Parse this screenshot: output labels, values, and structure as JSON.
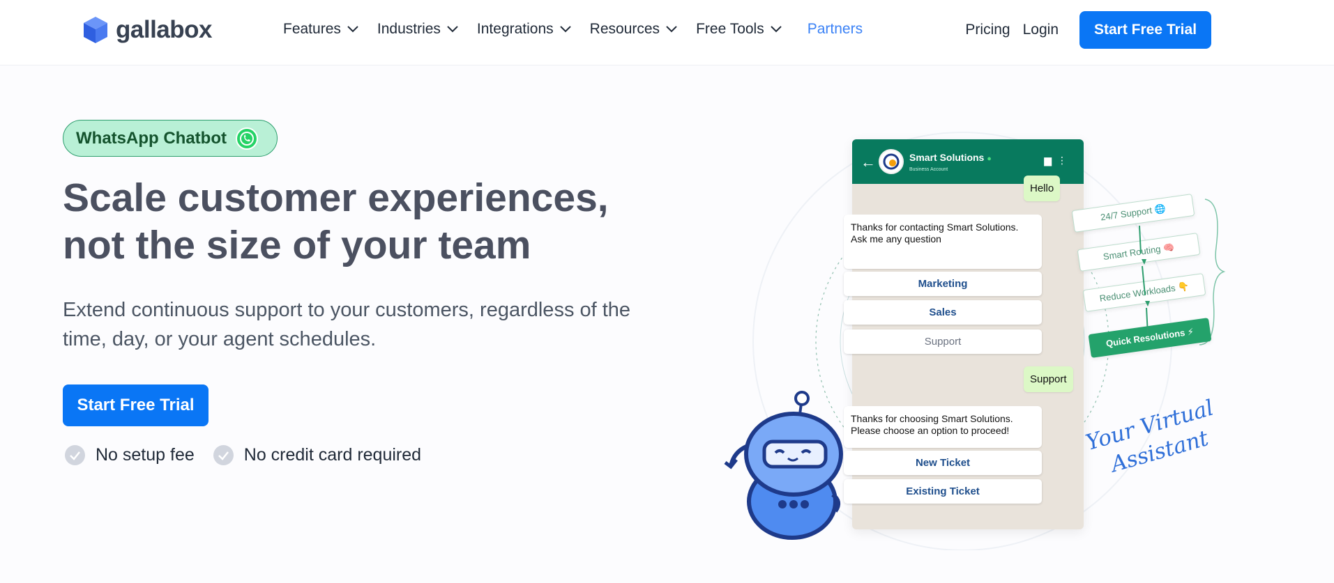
{
  "nav": {
    "logo": "gallabox",
    "menu": [
      {
        "label": "Features"
      },
      {
        "label": "Industries"
      },
      {
        "label": "Integrations"
      },
      {
        "label": "Resources"
      },
      {
        "label": "Free Tools"
      }
    ],
    "partners": "Partners",
    "pricing": "Pricing",
    "login": "Login",
    "cta": "Start Free Trial"
  },
  "hero": {
    "badge": "WhatsApp Chatbot",
    "headline": "Scale customer experiences, not the size of your team",
    "subline": "Extend continuous support to your customers, regardless of the time, day, or your agent schedules.",
    "cta": "Start Free Trial",
    "perks": [
      "No setup fee",
      "No credit card required"
    ]
  },
  "chat": {
    "business_name": "Smart Solutions",
    "business_sub": "Business Account",
    "hello": "Hello",
    "welcome_line1": "Thanks for contacting Smart Solutions.",
    "welcome_line2": "Ask me any question",
    "options1": [
      "Marketing",
      "Sales",
      "Support"
    ],
    "user_reply": "Support",
    "followup_line1": "Thanks for choosing Smart Solutions.",
    "followup_line2": "Please choose an option to proceed!",
    "options2": [
      "New Ticket",
      "Existing Ticket"
    ]
  },
  "flow": {
    "steps": [
      "24/7 Support 🌐",
      "Smart Routing 🧠",
      "Reduce Workloads 👇",
      "Quick Resolutions ⚡"
    ]
  },
  "assistant_caption_line1": "Your Virtual",
  "assistant_caption_line2": "Assistant",
  "colors": {
    "brand_blue": "#0a76f5",
    "partners_link": "#3b82f6",
    "badge_bg": "#b9f0d6",
    "whatsapp_header": "#087a5e",
    "flow_green": "#24a26b"
  }
}
